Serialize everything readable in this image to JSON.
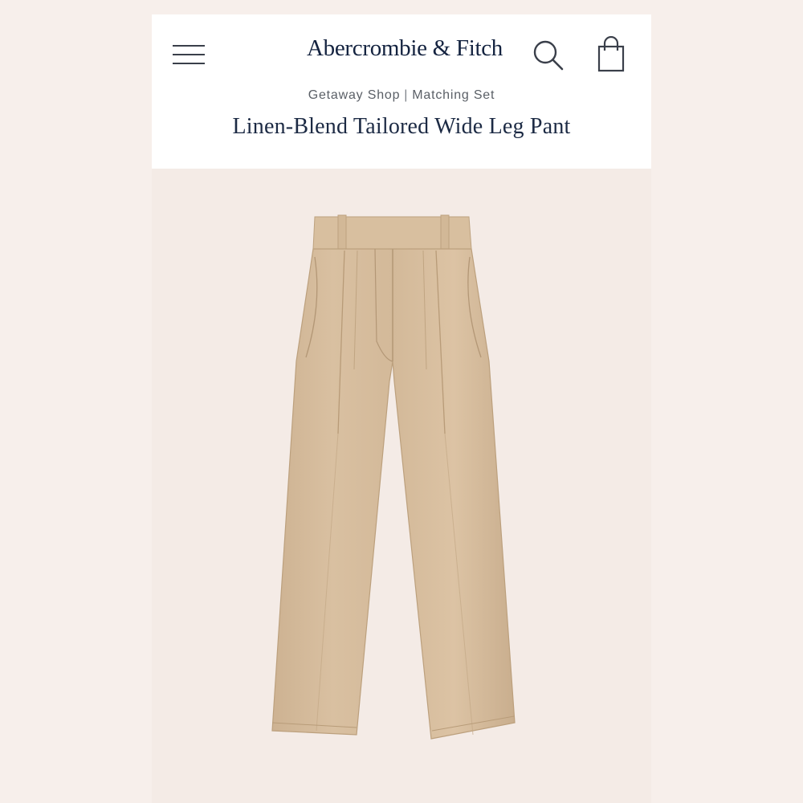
{
  "header": {
    "brand": "Abercrombie & Fitch",
    "icons": [
      "menu-icon",
      "search-icon",
      "shopping-bag-icon"
    ]
  },
  "breadcrumb": {
    "items": [
      "Getaway Shop",
      "Matching Set"
    ],
    "separator": "|"
  },
  "product": {
    "title": "Linen-Blend Tailored Wide Leg Pant",
    "image_description_color": "#d6bc9c"
  },
  "colors": {
    "header_background": "#ffffff",
    "page_background": "#f7efeb",
    "brand_text": "#142340",
    "title_text": "#1c2a44",
    "breadcrumb_text": "#5a5f66",
    "icon_stroke": "#3a3f4a"
  }
}
